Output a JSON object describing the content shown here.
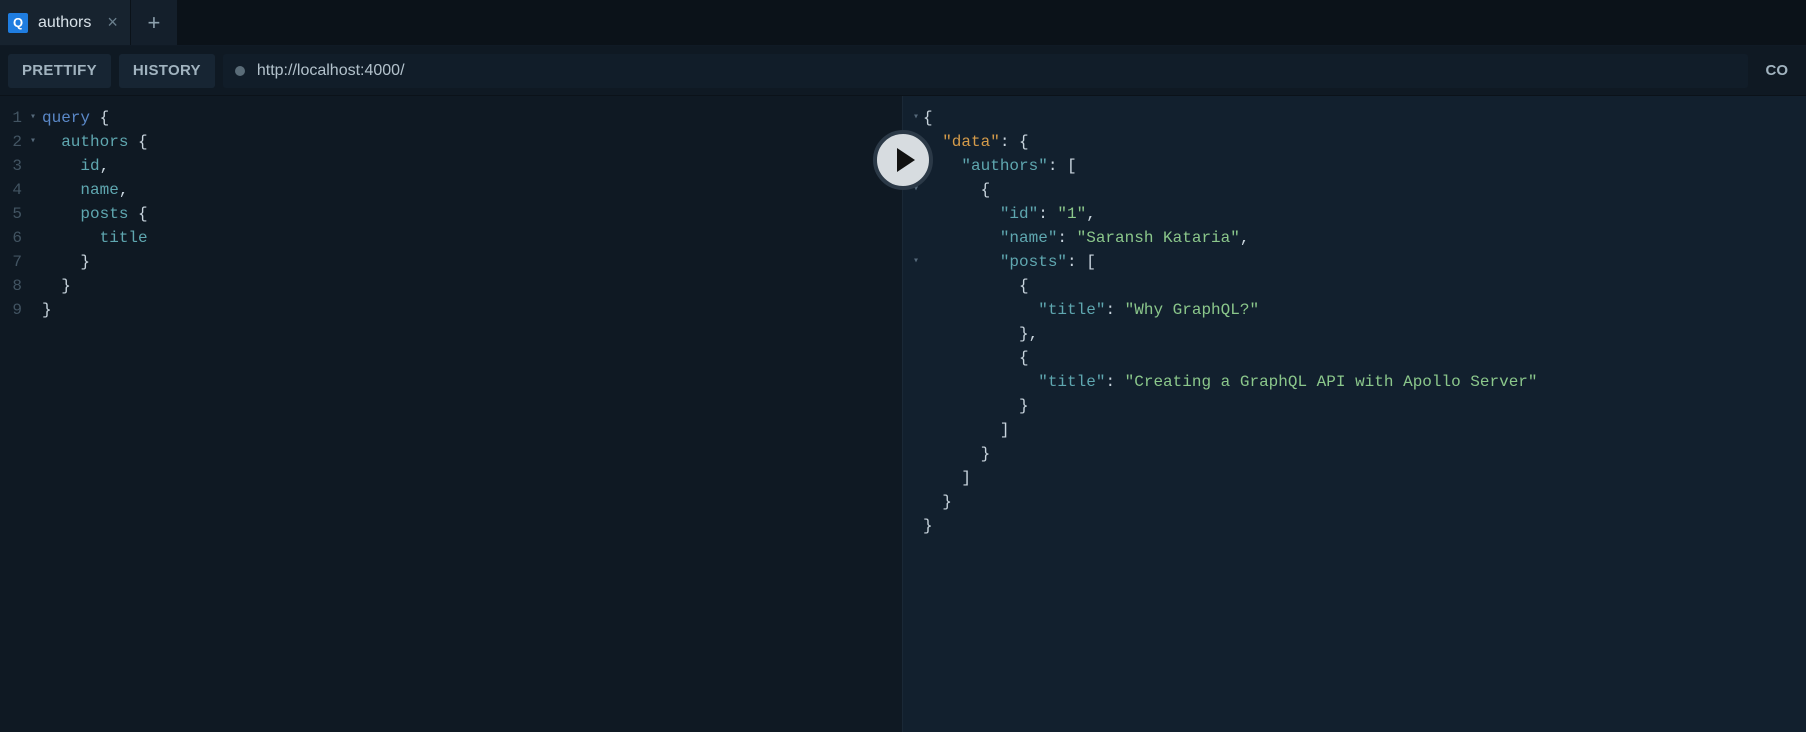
{
  "tabs": {
    "active": {
      "icon_letter": "Q",
      "label": "authors"
    }
  },
  "toolbar": {
    "prettify_label": "PRETTIFY",
    "history_label": "HISTORY",
    "endpoint": "http://localhost:4000/",
    "right_label": "CO"
  },
  "query": {
    "line_numbers": [
      "1",
      "2",
      "3",
      "4",
      "5",
      "6",
      "7",
      "8",
      "9"
    ],
    "fold_marks": [
      "▾",
      "▾",
      "",
      "",
      "",
      "",
      "",
      "",
      ""
    ],
    "tokens": {
      "l1_kw": "query",
      "l1_brace": " {",
      "l2_fd": "authors",
      "l2_brace": " {",
      "l3_fd": "id",
      "l3_comma": ",",
      "l4_fd": "name",
      "l4_comma": ",",
      "l5_fd": "posts",
      "l5_brace": " {",
      "l6_fd": "title",
      "l7": "}",
      "l8": "}",
      "l9": "}"
    }
  },
  "response": {
    "fold_marks": [
      "▾",
      "▾",
      "▾",
      "▾",
      "",
      "",
      "▾",
      "",
      "",
      "",
      "",
      "",
      "",
      "",
      "",
      "",
      "",
      ""
    ],
    "tokens": {
      "data_key": "\"data\"",
      "authors_key": "\"authors\"",
      "id_key": "\"id\"",
      "id_val": "\"1\"",
      "name_key": "\"name\"",
      "name_val": "\"Saransh Kataria\"",
      "posts_key": "\"posts\"",
      "title_key1": "\"title\"",
      "title_val1": "\"Why GraphQL?\"",
      "title_key2": "\"title\"",
      "title_val2": "\"Creating a GraphQL API with Apollo Server\""
    }
  },
  "chart_data": {
    "type": "table",
    "note": "GraphQL query and JSON response",
    "query_text": "query { authors { id, name, posts { title } } }",
    "response_json": {
      "data": {
        "authors": [
          {
            "id": "1",
            "name": "Saransh Kataria",
            "posts": [
              {
                "title": "Why GraphQL?"
              },
              {
                "title": "Creating a GraphQL API with Apollo Server"
              }
            ]
          }
        ]
      }
    }
  }
}
